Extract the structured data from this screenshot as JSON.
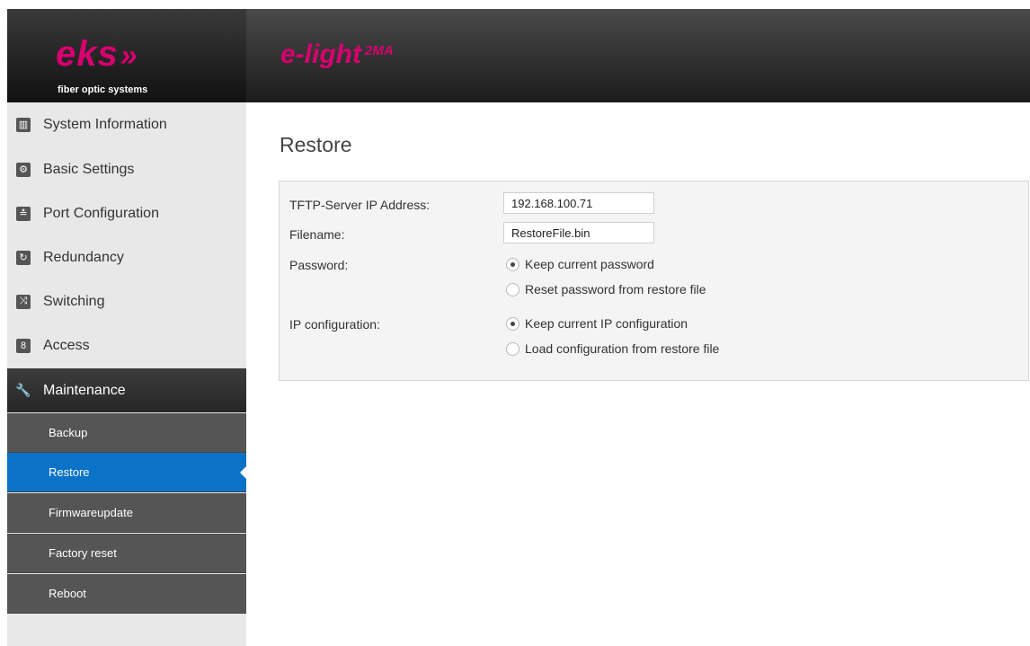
{
  "brand": {
    "logo_text": "eks",
    "logo_arrows": "»",
    "subtitle": "fiber optic systems"
  },
  "product": {
    "name": "e-light",
    "version": "2MA"
  },
  "sidebar": {
    "items": [
      {
        "label": "System Information",
        "icon": "bar-chart-icon",
        "glyph": "▥"
      },
      {
        "label": "Basic Settings",
        "icon": "gear-icon",
        "glyph": "⚙"
      },
      {
        "label": "Port Configuration",
        "icon": "sliders-icon",
        "glyph": "≛"
      },
      {
        "label": "Redundancy",
        "icon": "ring-icon",
        "glyph": "↻"
      },
      {
        "label": "Switching",
        "icon": "shuffle-icon",
        "glyph": "⤨"
      },
      {
        "label": "Access",
        "icon": "lock-icon",
        "glyph": "8"
      },
      {
        "label": "Maintenance",
        "icon": "wrench-icon",
        "glyph": "🔧"
      }
    ],
    "subitems": [
      {
        "label": "Backup"
      },
      {
        "label": "Restore"
      },
      {
        "label": "Firmwareupdate"
      },
      {
        "label": "Factory reset"
      },
      {
        "label": "Reboot"
      }
    ]
  },
  "main": {
    "title": "Restore",
    "form": {
      "tftp_label": "TFTP-Server IP Address:",
      "tftp_value": "192.168.100.71",
      "filename_label": "Filename:",
      "filename_value": "RestoreFile.bin",
      "password_label": "Password:",
      "password_options": [
        "Keep current password",
        "Reset password from restore file"
      ],
      "password_selected": "Keep current password",
      "ip_label": "IP configuration:",
      "ip_options": [
        "Keep current IP configuration",
        "Load configuration from restore file"
      ],
      "ip_selected": "Keep current IP configuration"
    }
  },
  "colors": {
    "brand_magenta": "#d7006f",
    "active_blue": "#0a73c8"
  }
}
